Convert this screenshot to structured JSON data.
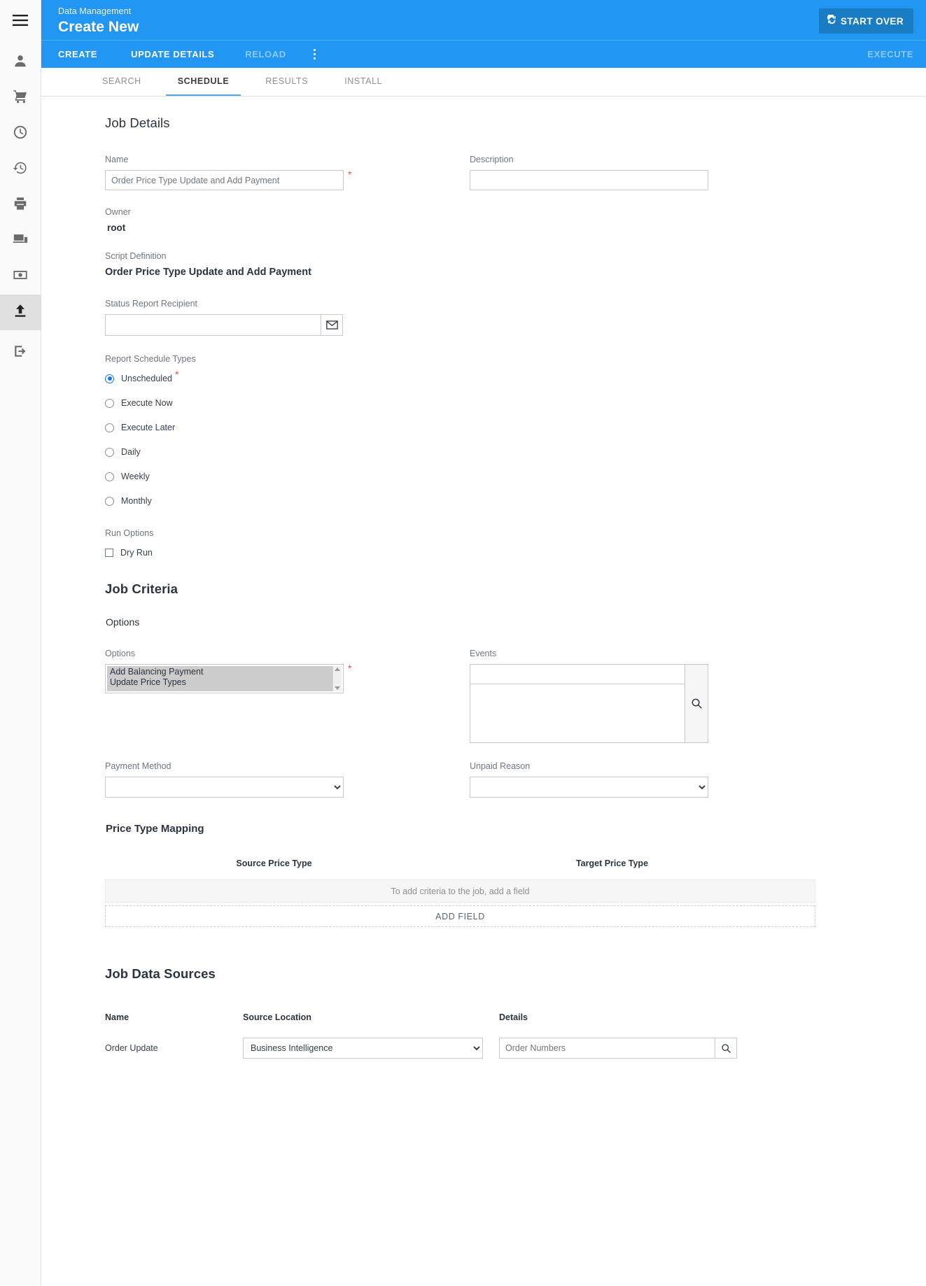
{
  "sidebar": {
    "items": [
      {
        "name": "menu-hamburger",
        "icon": "hamburger-icon",
        "active": false
      },
      {
        "name": "user",
        "icon": "person-icon",
        "active": false
      },
      {
        "name": "cart",
        "icon": "cart-icon",
        "active": false
      },
      {
        "name": "schedule",
        "icon": "clock-icon",
        "active": false
      },
      {
        "name": "history",
        "icon": "history-icon",
        "active": false
      },
      {
        "name": "print",
        "icon": "printer-icon",
        "active": false
      },
      {
        "name": "devices",
        "icon": "device-icon",
        "active": false
      },
      {
        "name": "payments",
        "icon": "money-icon",
        "active": false
      },
      {
        "name": "import",
        "icon": "upload-icon",
        "active": true
      },
      {
        "name": "logout",
        "icon": "exit-icon",
        "active": false
      }
    ]
  },
  "header": {
    "breadcrumb": "Data Management",
    "title": "Create New",
    "start_over_label": "START OVER",
    "accent_color": "#2196f3",
    "start_over_color": "#1a7dc4"
  },
  "actionbar": {
    "items": [
      {
        "label": "CREATE",
        "disabled": false
      },
      {
        "label": "UPDATE DETAILS",
        "disabled": false
      },
      {
        "label": "RELOAD",
        "disabled": true
      }
    ],
    "overflow_icon": "kebab-menu-icon",
    "execute_label": "EXECUTE"
  },
  "tabs": [
    {
      "label": "SEARCH",
      "active": false
    },
    {
      "label": "SCHEDULE",
      "active": true
    },
    {
      "label": "RESULTS",
      "active": false
    },
    {
      "label": "INSTALL",
      "active": false
    }
  ],
  "job_details": {
    "heading": "Job Details",
    "name_label": "Name",
    "name_value": "Order Price Type Update and Add Payment",
    "description_label": "Description",
    "description_value": "",
    "owner_label": "Owner",
    "owner_value": "root",
    "script_definition_label": "Script Definition",
    "script_definition_value": "Order Price Type Update and Add Payment",
    "status_recipient_label": "Status Report Recipient",
    "status_recipient_value": "",
    "status_recipient_icon": "envelope-icon",
    "schedule_types_label": "Report Schedule Types",
    "schedule_types": [
      {
        "label": "Unscheduled",
        "selected": true,
        "required": true
      },
      {
        "label": "Execute Now",
        "selected": false,
        "required": false
      },
      {
        "label": "Execute Later",
        "selected": false,
        "required": false
      },
      {
        "label": "Daily",
        "selected": false,
        "required": false
      },
      {
        "label": "Weekly",
        "selected": false,
        "required": false
      },
      {
        "label": "Monthly",
        "selected": false,
        "required": false
      }
    ],
    "run_options_label": "Run Options",
    "dry_run_label": "Dry Run",
    "dry_run_checked": false
  },
  "job_criteria": {
    "heading": "Job Criteria",
    "options_group_heading": "Options",
    "options_label": "Options",
    "options_items": [
      "Add Balancing Payment",
      "Update Price Types"
    ],
    "events_label": "Events",
    "events_value": "",
    "events_search_icon": "search-icon",
    "payment_method_label": "Payment Method",
    "payment_method_value": "",
    "unpaid_reason_label": "Unpaid Reason",
    "unpaid_reason_value": "",
    "price_type_mapping_heading": "Price Type Mapping",
    "mapping_columns": [
      "Source Price Type",
      "Target Price Type"
    ],
    "mapping_empty_text": "To add criteria to the job, add a field",
    "add_field_label": "ADD FIELD"
  },
  "job_data_sources": {
    "heading": "Job Data Sources",
    "columns": [
      "Name",
      "Source Location",
      "Details"
    ],
    "rows": [
      {
        "name": "Order Update",
        "source_location": "Business Intelligence",
        "details_placeholder": "Order Numbers",
        "details_value": "",
        "details_icon": "search-icon"
      }
    ]
  }
}
